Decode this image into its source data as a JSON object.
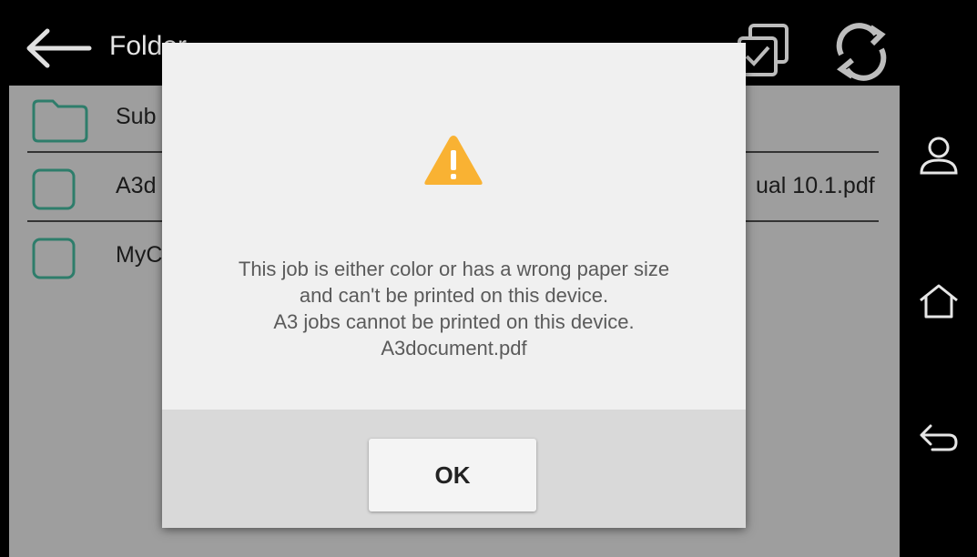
{
  "topbar": {
    "title": "Folder",
    "back_icon": "back-arrow-icon",
    "select_icon": "select-all-icon",
    "refresh_icon": "refresh-icon"
  },
  "list": {
    "items": [
      {
        "label": "Sub",
        "icon": "folder-icon"
      },
      {
        "label": "A3d",
        "label_right": "ual 10.1.pdf",
        "icon": "checkbox-icon"
      },
      {
        "label": "MyC",
        "icon": "checkbox-icon"
      }
    ]
  },
  "sidenav": {
    "items": [
      "user-icon",
      "home-icon",
      "return-icon"
    ]
  },
  "dialog": {
    "icon": "warning-icon",
    "message_lines": [
      "This job is either color or has a wrong paper size",
      "and can't be printed on this device.",
      "A3 jobs cannot be printed on this device.",
      "A3document.pdf"
    ],
    "ok_label": "OK"
  },
  "colors": {
    "accent": "#2e7d6b",
    "warning": "#f9b233",
    "dialog_bg": "#f0f0f0",
    "footer_bg": "#d9d9d9"
  }
}
